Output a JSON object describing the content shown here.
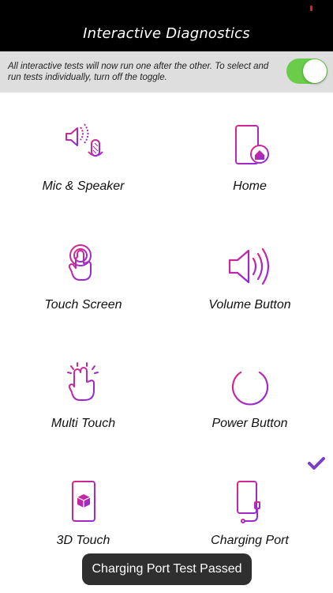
{
  "app": {
    "title": "Interactive Diagnostics"
  },
  "banner": {
    "message": "All interactive tests will now run one after the other. To select and run tests individually, turn off the toggle.",
    "toggle_on": true
  },
  "tests": [
    {
      "label": "Mic & Speaker",
      "icon": "mic-speaker-icon"
    },
    {
      "label": "Home",
      "icon": "home-button-icon"
    },
    {
      "label": "Touch Screen",
      "icon": "touch-screen-icon"
    },
    {
      "label": "Volume Button",
      "icon": "volume-icon"
    },
    {
      "label": "Multi Touch",
      "icon": "multi-touch-icon"
    },
    {
      "label": "Power Button",
      "icon": "power-icon"
    },
    {
      "label": "3D Touch",
      "icon": "3d-touch-icon"
    },
    {
      "label": "Charging Port",
      "icon": "charging-port-icon"
    }
  ],
  "toast": {
    "message": "Charging Port Test Passed"
  },
  "colors": {
    "accent_start": "#e0287f",
    "accent_end": "#8a2be2",
    "check": "#7b3fc4",
    "toggle": "#6acd4a"
  }
}
